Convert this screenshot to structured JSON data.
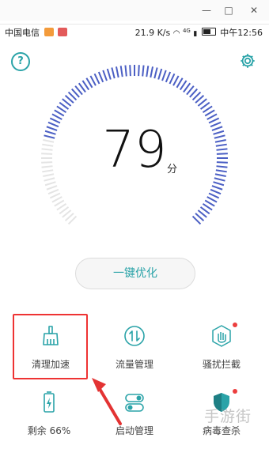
{
  "window": {
    "minimize_glyph": "—",
    "maximize_glyph": "□",
    "close_glyph": "✕"
  },
  "status_bar": {
    "carrier": "中国电信",
    "network_speed": "21.9 K/s",
    "signal_label": "4G",
    "time": "中午12:56",
    "badge_colors": [
      "#f39b3b",
      "#e35a5a"
    ]
  },
  "header": {
    "help_glyph": "?",
    "settings_icon": "gear-icon"
  },
  "gauge": {
    "score": "79",
    "unit": "分",
    "level": 0.79,
    "active_color": "#4b5fc4",
    "inactive_color": "#e4e4e4"
  },
  "optimize_button": {
    "label": "一键优化"
  },
  "tools": [
    {
      "label": "清理加速",
      "icon": "broom-icon",
      "badge": false
    },
    {
      "label": "流量管理",
      "icon": "traffic-icon",
      "badge": false
    },
    {
      "label": "骚扰拦截",
      "icon": "hand-icon",
      "badge": true
    },
    {
      "label": "剩余 66%",
      "icon": "battery-icon",
      "badge": false
    },
    {
      "label": "启动管理",
      "icon": "toggle-icon",
      "badge": false
    },
    {
      "label": "病毒查杀",
      "icon": "shield-icon",
      "badge": true
    }
  ],
  "accent_color": "#2aa3a8",
  "annotation": {
    "highlight_color": "#e33333"
  },
  "watermark": "手游街"
}
